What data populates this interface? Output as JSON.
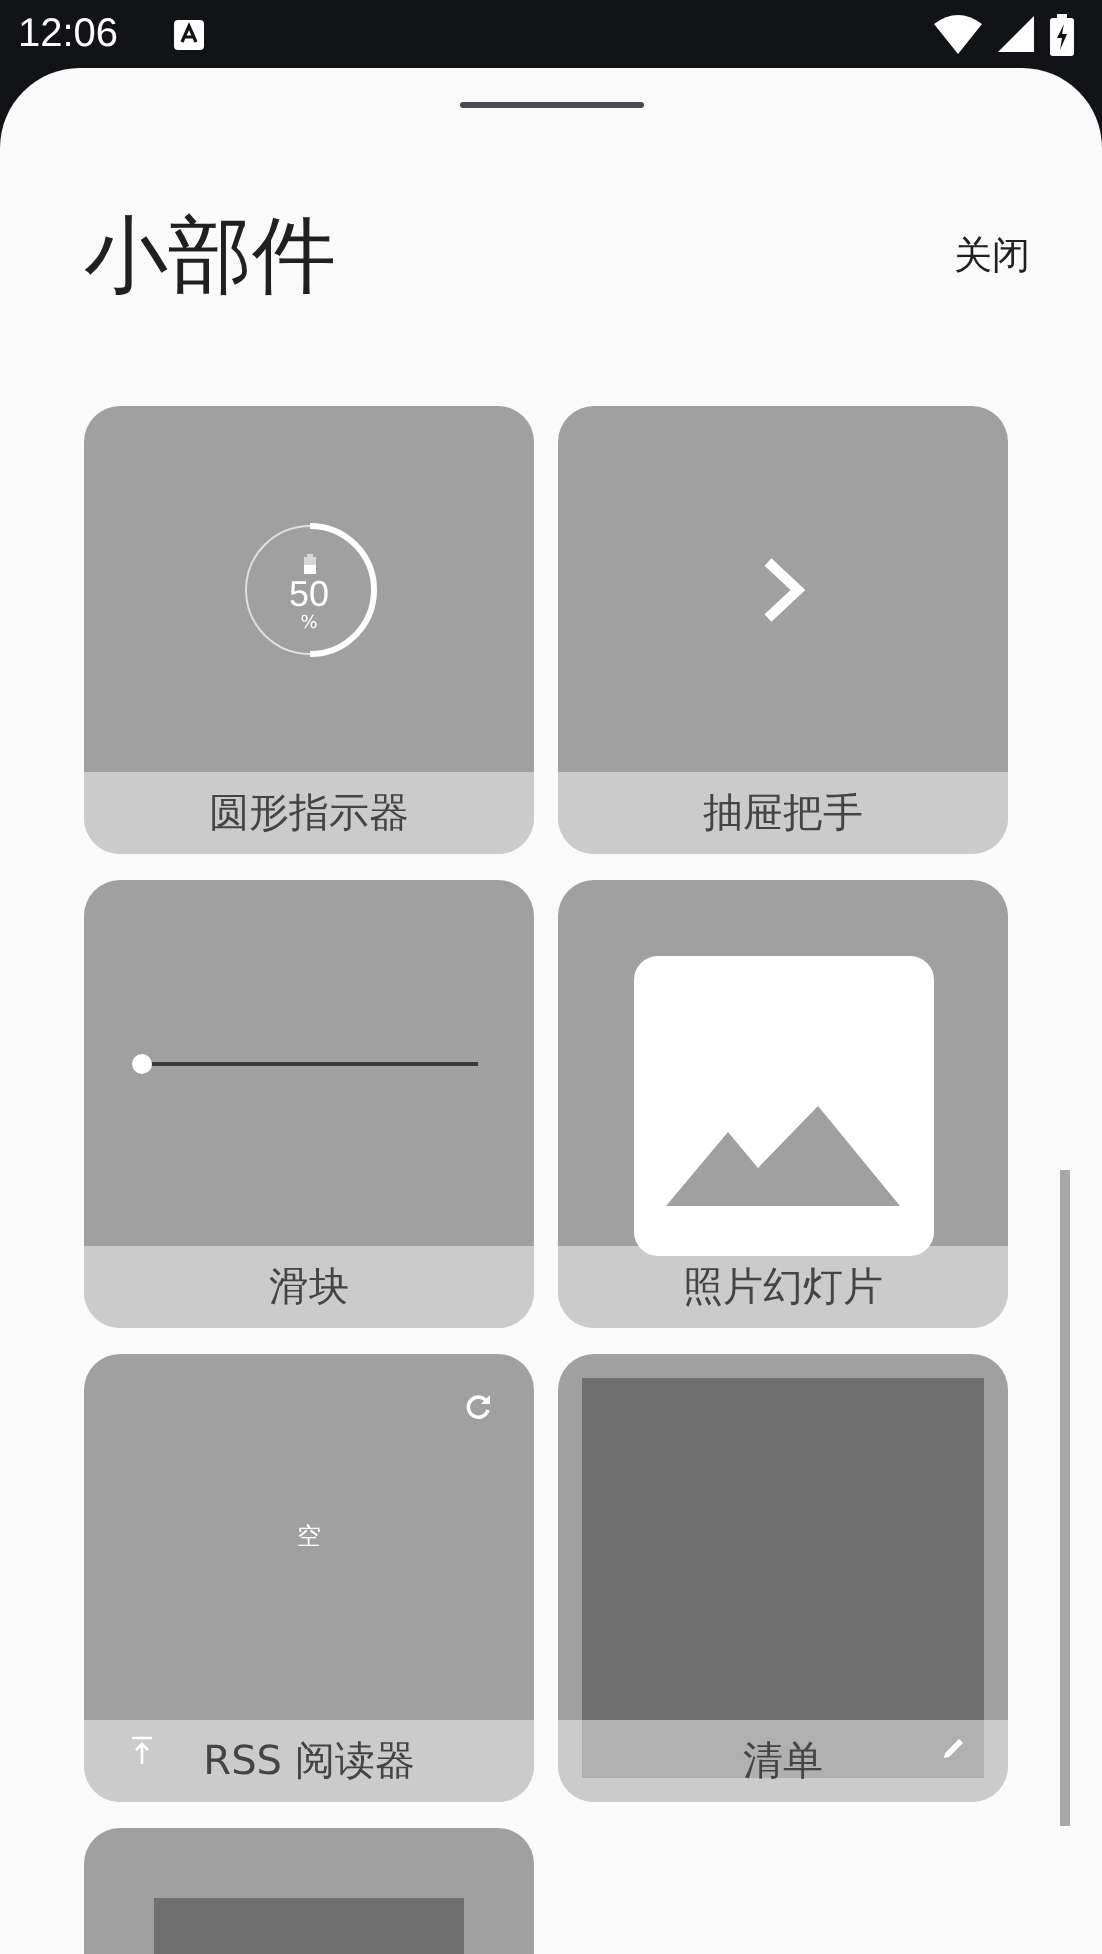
{
  "status_bar": {
    "time": "12:06"
  },
  "sheet": {
    "title": "小部件",
    "close": "关闭"
  },
  "widgets": [
    {
      "kind": "circle",
      "label": "圆形指示器",
      "value": "50",
      "unit": "%",
      "level": 0.5
    },
    {
      "kind": "drawer",
      "label": "抽屉把手"
    },
    {
      "kind": "slider",
      "label": "滑块",
      "level": 0
    },
    {
      "kind": "slideshow",
      "label": "照片幻灯片"
    },
    {
      "kind": "rss",
      "label": "RSS 阅读器",
      "empty": "空"
    },
    {
      "kind": "list",
      "label": "清单"
    },
    {
      "kind": "partial"
    }
  ]
}
